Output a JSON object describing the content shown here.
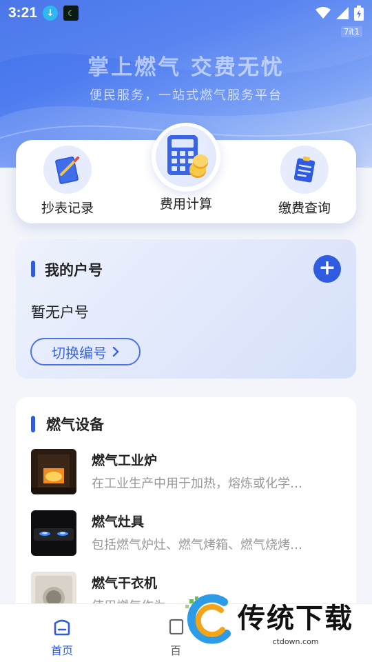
{
  "status_bar": {
    "time": "3:21",
    "carrier_tag": "7it1",
    "icons": [
      "download-icon",
      "app-notify-icon",
      "wifi-icon",
      "signal-icon",
      "battery-charging-icon"
    ]
  },
  "hero": {
    "title": "掌上燃气 交费无忧",
    "subtitle": "便民服务，一站式燃气服务平台"
  },
  "quick_actions": [
    {
      "label": "抄表记录",
      "icon": "notebook-pen-icon"
    },
    {
      "label": "费用计算",
      "icon": "calculator-coins-icon"
    },
    {
      "label": "缴费查询",
      "icon": "document-clipboard-icon"
    }
  ],
  "account": {
    "title": "我的户号",
    "add_icon": "plus-icon",
    "empty_text": "暂无户号",
    "switch_label": "切换编号"
  },
  "equipment": {
    "title": "燃气设备",
    "items": [
      {
        "name": "燃气工业炉",
        "desc": "在工业生产中用于加热，熔炼或化学…"
      },
      {
        "name": "燃气灶具",
        "desc": "包括燃气炉灶、燃气烤箱、燃气烧烤…"
      },
      {
        "name": "燃气干衣机",
        "desc": "使用燃气作为…"
      }
    ]
  },
  "tabbar": {
    "tabs": [
      {
        "label": "首页",
        "active": true
      },
      {
        "label": "百",
        "active": false
      }
    ]
  },
  "watermark": {
    "main": "传统下载",
    "sub": "ctdown.com"
  },
  "colors": {
    "brand": "#2e5be0",
    "hero_start": "#3f6ee8",
    "hero_end": "#b9cdf7",
    "page_bg": "#f3f5fa"
  }
}
